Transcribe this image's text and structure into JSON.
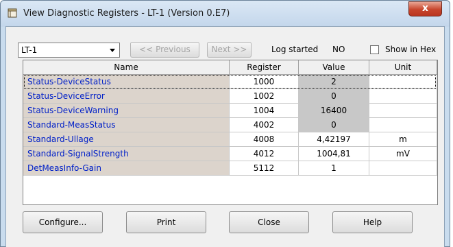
{
  "window": {
    "title": "View Diagnostic Registers - LT-1 (Version 0.E7)",
    "close_label": "x"
  },
  "toolbar": {
    "device_selected": "LT-1",
    "previous_label": "<< Previous",
    "next_label": "Next >>",
    "log_label": "Log started",
    "log_value": "NO",
    "show_hex_label": "Show in Hex",
    "show_hex_checked": false
  },
  "table": {
    "columns": [
      "Name",
      "Register",
      "Value",
      "Unit"
    ],
    "rows": [
      {
        "name": "Status-DeviceStatus",
        "register": "1000",
        "value": "2",
        "unit": "",
        "highlight": true
      },
      {
        "name": "Status-DeviceError",
        "register": "1002",
        "value": "0",
        "unit": "",
        "highlight": true
      },
      {
        "name": "Status-DeviceWarning",
        "register": "1004",
        "value": "16400",
        "unit": "",
        "highlight": true
      },
      {
        "name": "Standard-MeasStatus",
        "register": "4002",
        "value": "0",
        "unit": "",
        "highlight": true
      },
      {
        "name": "Standard-Ullage",
        "register": "4008",
        "value": "4,42197",
        "unit": "m",
        "highlight": false
      },
      {
        "name": "Standard-SignalStrength",
        "register": "4012",
        "value": "1004,81",
        "unit": "mV",
        "highlight": false
      },
      {
        "name": "DetMeasInfo-Gain",
        "register": "5112",
        "value": "1",
        "unit": "",
        "highlight": false
      }
    ]
  },
  "buttons": {
    "configure": "Configure...",
    "print": "Print",
    "close": "Close",
    "help": "Help"
  }
}
